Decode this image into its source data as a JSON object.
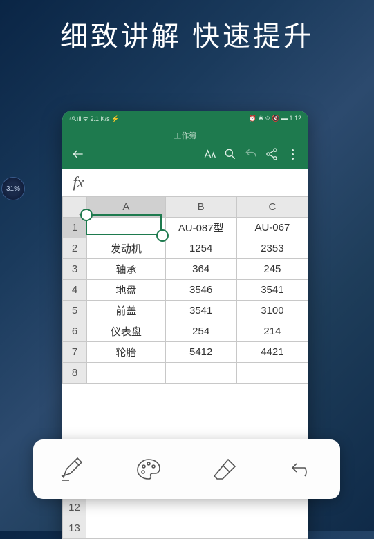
{
  "title": "细致讲解 快速提升",
  "badge": "31%",
  "status": {
    "left": "⁴ᴳ.ıll ᯤ 2.1 K/s ⚡",
    "right": "⏰ ✱ ⟐ 🔇 ▬ 1:12"
  },
  "app": {
    "title": "工作簿"
  },
  "fx": "fx",
  "columns": [
    "A",
    "B",
    "C"
  ],
  "rows": [
    "1",
    "2",
    "3",
    "4",
    "5",
    "6",
    "7",
    "8"
  ],
  "extra_rows": [
    "12",
    "13"
  ],
  "chart_data": {
    "type": "table",
    "columns": [
      "",
      "A",
      "B",
      "C"
    ],
    "data": [
      {
        "row": "1",
        "A": "",
        "B": "AU-087型",
        "C": "AU-067"
      },
      {
        "row": "2",
        "A": "发动机",
        "B": "1254",
        "C": "2353"
      },
      {
        "row": "3",
        "A": "轴承",
        "B": "364",
        "C": "245"
      },
      {
        "row": "4",
        "A": "地盘",
        "B": "3546",
        "C": "3541"
      },
      {
        "row": "5",
        "A": "前盖",
        "B": "3541",
        "C": "3100"
      },
      {
        "row": "6",
        "A": "仪表盘",
        "B": "254",
        "C": "214"
      },
      {
        "row": "7",
        "A": "轮胎",
        "B": "5412",
        "C": "4421"
      },
      {
        "row": "8",
        "A": "",
        "B": "",
        "C": ""
      }
    ]
  }
}
